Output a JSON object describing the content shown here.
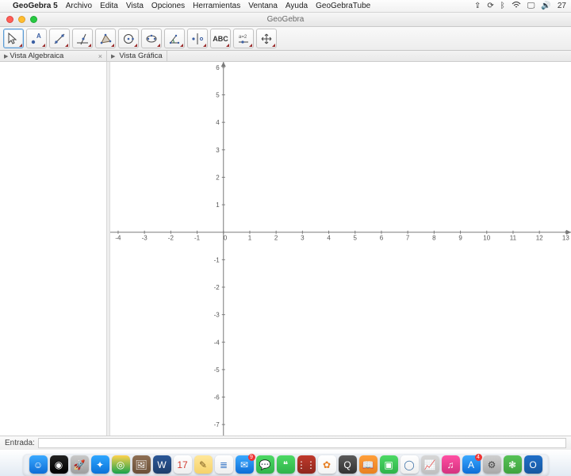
{
  "menubar": {
    "apple": "",
    "app_name": "GeoGebra 5",
    "items": [
      "Archivo",
      "Edita",
      "Vista",
      "Opciones",
      "Herramientas",
      "Ventana",
      "Ayuda",
      "GeoGebraTube"
    ],
    "status": {
      "time": "27"
    }
  },
  "window": {
    "title": "GeoGebra"
  },
  "toolbar": {
    "tools": [
      {
        "name": "move-tool",
        "selected": true
      },
      {
        "name": "point-tool"
      },
      {
        "name": "line-tool"
      },
      {
        "name": "perpendicular-tool"
      },
      {
        "name": "polygon-tool"
      },
      {
        "name": "circle-tool"
      },
      {
        "name": "ellipse-tool"
      },
      {
        "name": "angle-tool"
      },
      {
        "name": "reflect-tool"
      },
      {
        "name": "text-tool",
        "label": "ABC"
      },
      {
        "name": "slider-tool",
        "label": "a=2"
      },
      {
        "name": "move-view-tool"
      }
    ]
  },
  "views": {
    "algebra": "Vista Algebraica",
    "graph": "Vista Gráfica"
  },
  "input": {
    "label": "Entrada:"
  },
  "chart_data": {
    "type": "scatter",
    "title": "",
    "xlabel": "",
    "ylabel": "",
    "x_ticks": [
      -4,
      -3,
      -2,
      -1,
      0,
      1,
      2,
      3,
      4,
      5,
      6,
      7,
      8,
      9,
      10,
      11,
      12,
      13
    ],
    "y_ticks": [
      -7,
      -6,
      -5,
      -4,
      -3,
      -2,
      -1,
      0,
      1,
      2,
      3,
      4,
      5,
      6
    ],
    "xlim": [
      -4.3,
      13.2
    ],
    "ylim": [
      -7.4,
      6.2
    ],
    "series": []
  },
  "dock": {
    "apps": [
      {
        "name": "finder",
        "color1": "#3aa9ff",
        "color2": "#0d6dd6",
        "glyph": "☺"
      },
      {
        "name": "siri",
        "color1": "#222",
        "color2": "#000",
        "glyph": "◉"
      },
      {
        "name": "launchpad",
        "color1": "#c9c9c9",
        "color2": "#9e9e9e",
        "glyph": "🚀"
      },
      {
        "name": "safari",
        "color1": "#2ea6ff",
        "color2": "#0a72d8",
        "glyph": "✦"
      },
      {
        "name": "chrome",
        "color1": "#ffd24d",
        "color2": "#17a24c",
        "glyph": "◎"
      },
      {
        "name": "preview",
        "color1": "#8e6f54",
        "color2": "#6a4f37",
        "glyph": "🖼"
      },
      {
        "name": "word",
        "color1": "#2b5797",
        "color2": "#1d3e6c",
        "glyph": "W"
      },
      {
        "name": "calendar",
        "color1": "#ffffff",
        "color2": "#efefef",
        "glyph": "17",
        "text": "#d23a2f"
      },
      {
        "name": "notes",
        "color1": "#ffe79a",
        "color2": "#f6d26a",
        "glyph": "✎",
        "text": "#7a5a1d"
      },
      {
        "name": "reminders",
        "color1": "#ffffff",
        "color2": "#efefef",
        "glyph": "≣",
        "text": "#3a78c6"
      },
      {
        "name": "mail",
        "color1": "#3aa9ff",
        "color2": "#0d6dd6",
        "glyph": "✉",
        "badge": "9"
      },
      {
        "name": "messages",
        "color1": "#4cd964",
        "color2": "#2fb34a",
        "glyph": "💬"
      },
      {
        "name": "wechat",
        "color1": "#4cd964",
        "color2": "#2fb34a",
        "glyph": "❝"
      },
      {
        "name": "tiles",
        "color1": "#c0392b",
        "color2": "#8e281e",
        "glyph": "⋮⋮"
      },
      {
        "name": "photos",
        "color1": "#ffffff",
        "color2": "#f4f4f4",
        "glyph": "✿",
        "text": "#e67e22"
      },
      {
        "name": "quicktime",
        "color1": "#5a5a5a",
        "color2": "#333",
        "glyph": "Q"
      },
      {
        "name": "ibooks",
        "color1": "#ff9f3a",
        "color2": "#e88120",
        "glyph": "📖"
      },
      {
        "name": "facetime",
        "color1": "#4cd964",
        "color2": "#2fb34a",
        "glyph": "▣"
      },
      {
        "name": "geogebra",
        "color1": "#ffffff",
        "color2": "#eeeeee",
        "glyph": "◯",
        "text": "#3a6fa5"
      },
      {
        "name": "activity",
        "color1": "#d7d7d7",
        "color2": "#bfbfbf",
        "glyph": "📈",
        "text": "#333"
      },
      {
        "name": "itunes",
        "color1": "#ff4fa3",
        "color2": "#d4337f",
        "glyph": "♫"
      },
      {
        "name": "appstore",
        "color1": "#3aa9ff",
        "color2": "#0d6dd6",
        "glyph": "A",
        "badge": "4"
      },
      {
        "name": "prefs",
        "color1": "#cfcfcf",
        "color2": "#a8a8a8",
        "glyph": "⚙",
        "text": "#444"
      },
      {
        "name": "evernote",
        "color1": "#57c257",
        "color2": "#3fa33f",
        "glyph": "❃"
      },
      {
        "name": "outlook",
        "color1": "#1f6fc8",
        "color2": "#1757a0",
        "glyph": "O"
      }
    ]
  }
}
